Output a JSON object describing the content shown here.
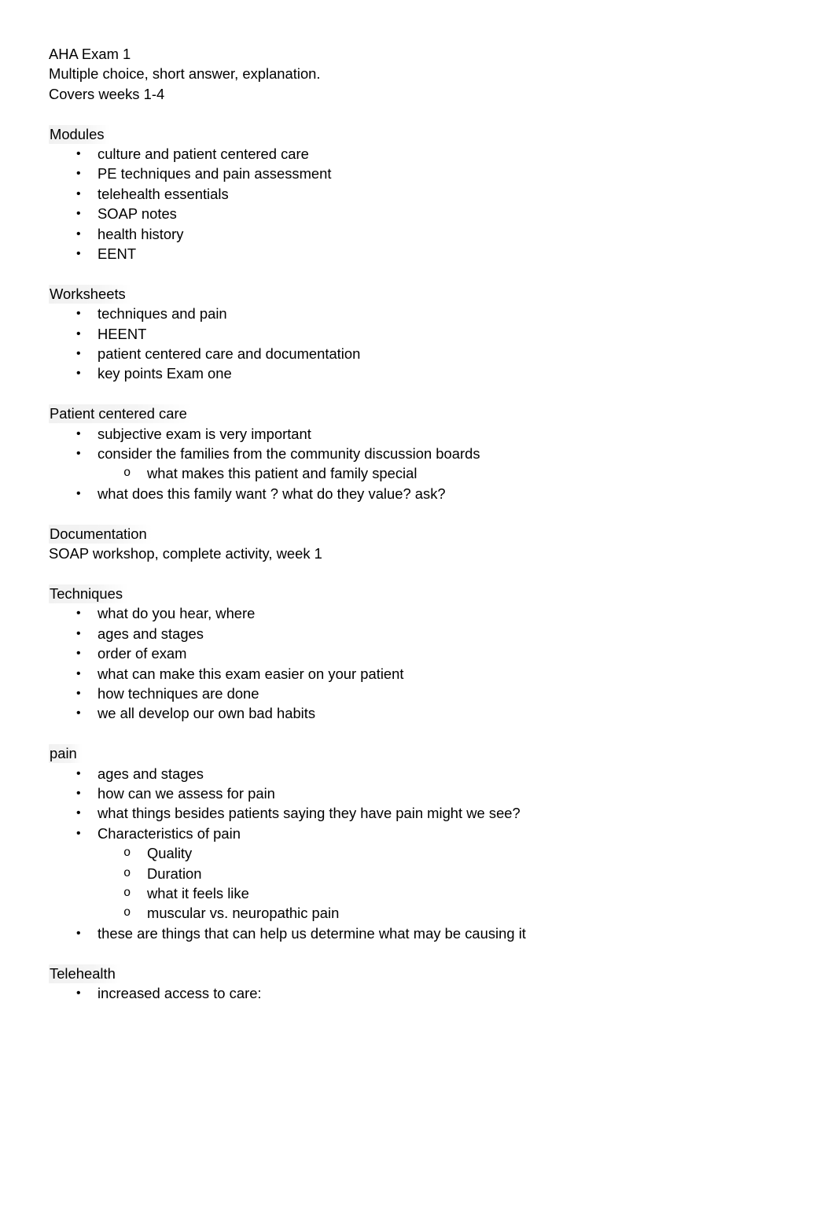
{
  "document": {
    "title_lines": [
      "AHA Exam 1",
      "Multiple choice, short answer, explanation.",
      "Covers weeks 1-4"
    ],
    "bullet_glyph": "•",
    "subbullet_glyph": "o",
    "sections": [
      {
        "heading": "Modules",
        "items": [
          {
            "text": "culture and patient centered care"
          },
          {
            "text": "PE techniques and pain assessment"
          },
          {
            "text": "telehealth essentials"
          },
          {
            "text": "SOAP notes"
          },
          {
            "text": "health history"
          },
          {
            "text": "EENT"
          }
        ]
      },
      {
        "heading": "Worksheets",
        "items": [
          {
            "text": "techniques and pain"
          },
          {
            "text": "HEENT"
          },
          {
            "text": "patient centered care and documentation"
          },
          {
            "text": "key points Exam one"
          }
        ]
      },
      {
        "heading": "Patient centered care",
        "items": [
          {
            "text": "subjective exam is very important"
          },
          {
            "text": "consider the families from the community discussion boards",
            "subitems": [
              "what makes this patient and family special"
            ]
          },
          {
            "text": "what does this family want ? what do they value? ask?"
          }
        ]
      },
      {
        "heading": "Documentation",
        "plain_lines": [
          "SOAP workshop, complete activity, week 1"
        ],
        "items": []
      },
      {
        "heading": "Techniques",
        "items": [
          {
            "text": "what do you hear, where"
          },
          {
            "text": "ages and stages"
          },
          {
            "text": "order of exam"
          },
          {
            "text": "what can make this exam easier on your patient"
          },
          {
            "text": "how techniques are done"
          },
          {
            "text": "we all develop our own bad habits"
          }
        ]
      },
      {
        "heading": "pain",
        "items": [
          {
            "text": "ages and stages"
          },
          {
            "text": "how can we assess for pain"
          },
          {
            "text": "what things besides patients saying they have pain might we see?"
          },
          {
            "text": "Characteristics of pain",
            "subitems": [
              "Quality",
              "Duration",
              "what it feels like",
              "muscular vs. neuropathic pain"
            ]
          },
          {
            "text": "these are things that can help us determine what may be causing it"
          }
        ]
      },
      {
        "heading": "Telehealth",
        "items": [
          {
            "text": "increased access to care:"
          }
        ]
      }
    ]
  }
}
